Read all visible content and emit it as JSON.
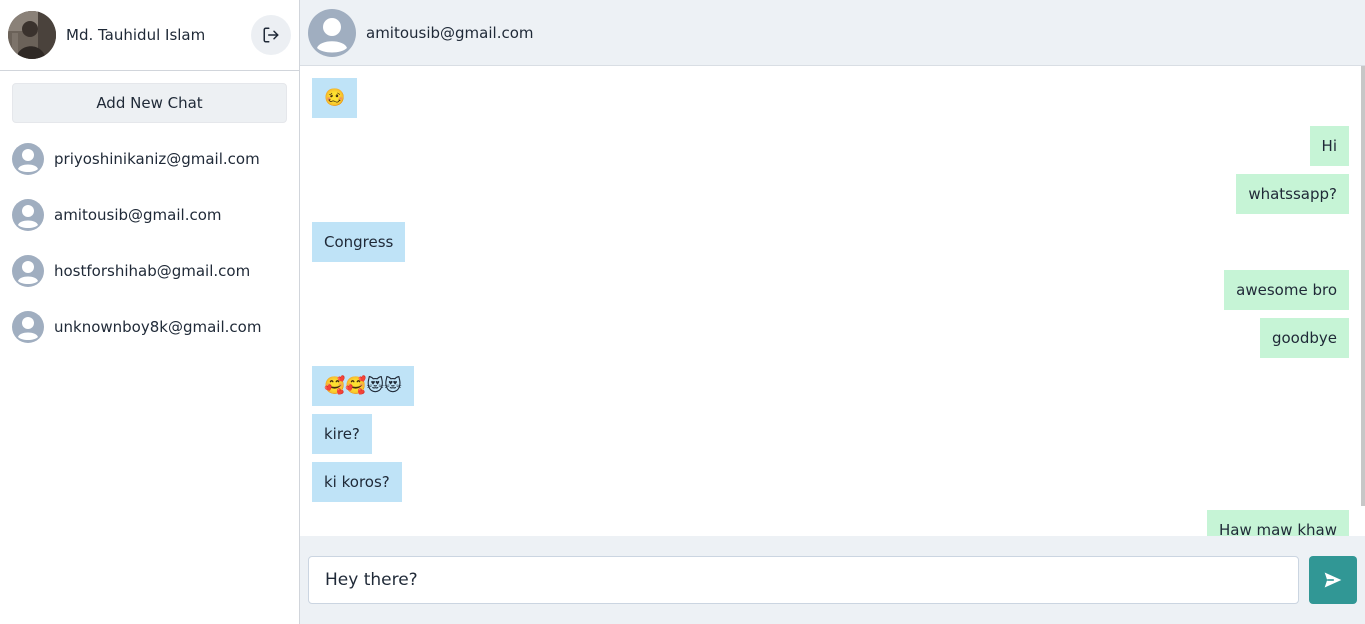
{
  "sidebar": {
    "user_name": "Md. Tauhidul Islam",
    "add_chat_label": "Add New Chat",
    "contacts": [
      {
        "email": "priyoshinikaniz@gmail.com"
      },
      {
        "email": "amitousib@gmail.com"
      },
      {
        "email": "hostforshihab@gmail.com"
      },
      {
        "email": "unknownboy8k@gmail.com"
      }
    ]
  },
  "chat": {
    "title": "amitousib@gmail.com",
    "messages": [
      {
        "dir": "in",
        "text": "🥴"
      },
      {
        "dir": "out",
        "text": "Hi"
      },
      {
        "dir": "out",
        "text": "whatssapp?"
      },
      {
        "dir": "in",
        "text": "Congress"
      },
      {
        "dir": "out",
        "text": "awesome bro"
      },
      {
        "dir": "out",
        "text": "goodbye"
      },
      {
        "dir": "in",
        "text": "🥰🥰😻😻"
      },
      {
        "dir": "in",
        "text": "kire?"
      },
      {
        "dir": "in",
        "text": "ki koros?"
      },
      {
        "dir": "out",
        "text": "Haw maw khaw"
      }
    ]
  },
  "composer": {
    "value": "Hey there?"
  },
  "colors": {
    "incoming_bubble": "#bfe3f7",
    "outgoing_bubble": "#c6f4d6",
    "send_button": "#319795"
  },
  "icons": {
    "logout": "logout-icon",
    "send": "send-icon",
    "avatar": "user-avatar-icon"
  }
}
